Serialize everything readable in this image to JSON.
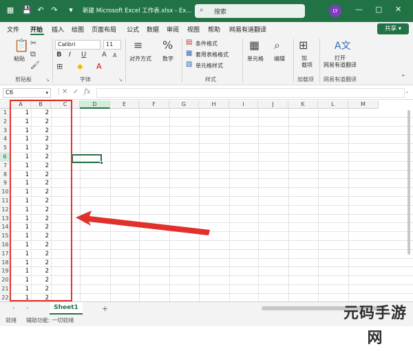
{
  "titlebar": {
    "title": "新建 Microsoft Excel 工作表.xlsx - Ex...",
    "search_placeholder": "搜索",
    "user_initials": "LY"
  },
  "tabs": [
    "文件",
    "开始",
    "插入",
    "绘图",
    "页面布局",
    "公式",
    "数据",
    "审阅",
    "视图",
    "帮助",
    "网易有道翻译"
  ],
  "active_tab": "开始",
  "share_label": "共享",
  "ribbon": {
    "paste_label": "粘贴",
    "clipboard_group": "剪贴板",
    "font_name": "Calibri",
    "font_size": "11",
    "font_group": "字体",
    "align_label": "对齐方式",
    "number_label": "数字",
    "conditional_format": "条件格式",
    "table_format": "套用表格格式",
    "cell_styles": "单元格样式",
    "styles_group": "样式",
    "cells_label": "单元格",
    "editing_label": "编辑",
    "addins_label": "加\n载项",
    "addins_group": "加载项",
    "open_label": "打开\n网易有道翻译",
    "youdao_group": "网易有道翻译"
  },
  "formula_bar": {
    "name_box": "C6",
    "fx": "fx",
    "content": ""
  },
  "grid": {
    "columns": [
      "A",
      "B",
      "C",
      "D",
      "E",
      "F",
      "G",
      "H",
      "I",
      "J",
      "K",
      "L",
      "M"
    ],
    "selected_column": "D",
    "selected_row": 6,
    "rows": [
      {
        "n": 1,
        "a": "1",
        "b": "2"
      },
      {
        "n": 2,
        "a": "1",
        "b": "2"
      },
      {
        "n": 3,
        "a": "1",
        "b": "2"
      },
      {
        "n": 4,
        "a": "1",
        "b": "2"
      },
      {
        "n": 5,
        "a": "1",
        "b": "2"
      },
      {
        "n": 6,
        "a": "1",
        "b": "2"
      },
      {
        "n": 7,
        "a": "1",
        "b": "2"
      },
      {
        "n": 8,
        "a": "1",
        "b": "2"
      },
      {
        "n": 9,
        "a": "1",
        "b": "2"
      },
      {
        "n": 10,
        "a": "1",
        "b": "2"
      },
      {
        "n": 11,
        "a": "1",
        "b": "2"
      },
      {
        "n": 12,
        "a": "1",
        "b": "2"
      },
      {
        "n": 13,
        "a": "1",
        "b": "2"
      },
      {
        "n": 14,
        "a": "1",
        "b": "2"
      },
      {
        "n": 15,
        "a": "1",
        "b": "2"
      },
      {
        "n": 16,
        "a": "1",
        "b": "2"
      },
      {
        "n": 17,
        "a": "1",
        "b": "2"
      },
      {
        "n": 18,
        "a": "1",
        "b": "2"
      },
      {
        "n": 19,
        "a": "1",
        "b": "2"
      },
      {
        "n": 20,
        "a": "1",
        "b": "2"
      },
      {
        "n": 21,
        "a": "1",
        "b": "2"
      },
      {
        "n": 22,
        "a": "1",
        "b": "2"
      }
    ]
  },
  "sheet_tab": "Sheet1",
  "status": {
    "ready": "就绪",
    "accessibility": "辅助功能: 一切就绪"
  },
  "watermark": "元码手游网",
  "colors": {
    "accent": "#217346",
    "annotation_red": "#e0312b"
  }
}
